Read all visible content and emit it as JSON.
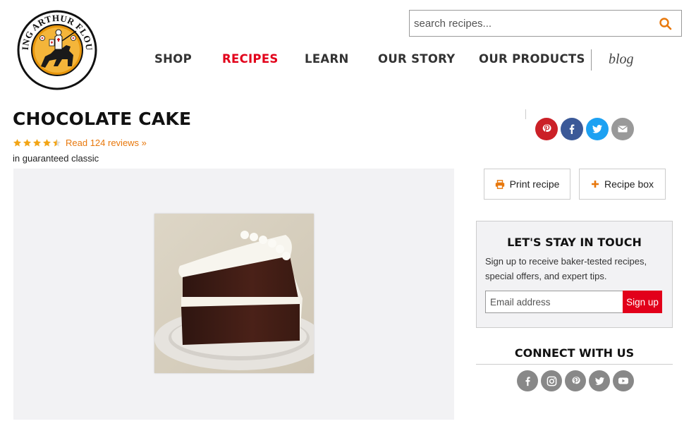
{
  "header": {
    "logo_text": "KING ARTHUR FLOUR",
    "search": {
      "placeholder": "search recipes..."
    },
    "nav": [
      {
        "label": "SHOP"
      },
      {
        "label": "RECIPES",
        "active": true
      },
      {
        "label": "LEARN"
      },
      {
        "label": "OUR STORY"
      },
      {
        "label": "OUR PRODUCTS"
      }
    ],
    "blog_label": "blog"
  },
  "recipe": {
    "title": "CHOCOLATE CAKE",
    "rating": 4.5,
    "rating_max": 5,
    "reviews_label": "Read 124 reviews »",
    "category_text": "in guaranteed classic"
  },
  "share_icons": [
    "pinterest-icon",
    "facebook-icon",
    "twitter-icon",
    "email-icon"
  ],
  "actions": {
    "print_label": "Print recipe",
    "recipe_box_label": "Recipe box"
  },
  "newsletter": {
    "title": "LET'S STAY IN TOUCH",
    "description": "Sign up to receive baker-tested recipes, special offers, and expert tips.",
    "email_placeholder": "Email address",
    "signup_label": "Sign up"
  },
  "connect": {
    "title": "CONNECT WITH US",
    "icons": [
      "facebook-icon",
      "instagram-icon",
      "pinterest-icon",
      "twitter-icon",
      "youtube-icon"
    ]
  },
  "colors": {
    "brand_red": "#e2001a",
    "link_orange": "#e8780c",
    "pinterest": "#cb2027",
    "facebook": "#3b5998",
    "twitter": "#1da1f2",
    "email": "#999999",
    "social_gray": "#888888"
  }
}
